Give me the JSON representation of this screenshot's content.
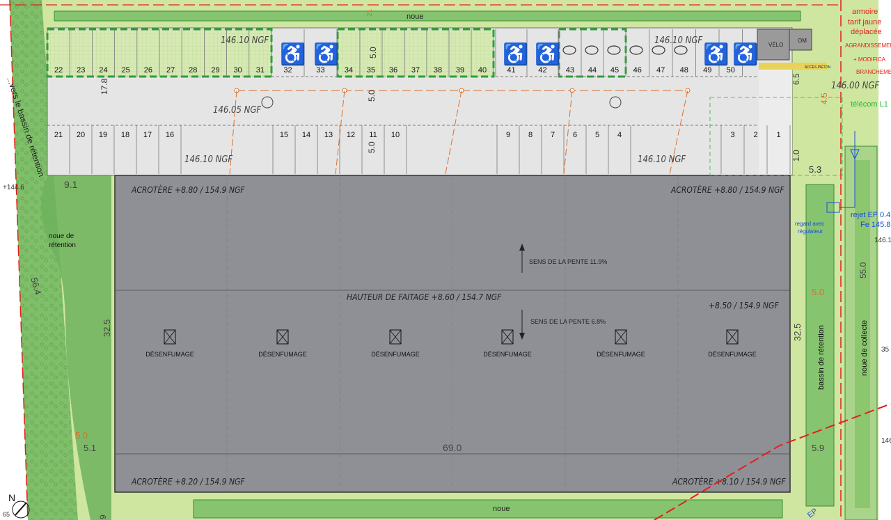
{
  "colors": {
    "background": "#ffffff",
    "green_light": "#cfe6a0",
    "green_mid": "#86c46f",
    "green_dark": "#5ea85a",
    "roof": "#8f9096",
    "pavement": "#e5e5e5",
    "parking_dash": "#2f9e3b",
    "red_line": "#e0211a",
    "sewer": "#d9702a",
    "blue_note": "#1a4fd6",
    "green_note": "#22b83a"
  },
  "labels": {
    "noue_top": "noue",
    "noue_bottom": "noue",
    "noue_retention": "noue de\nrétention",
    "left_vertical": "...vers le bassin de rétention",
    "left_side_value": "+144.6",
    "left_dim_564": "56.4",
    "left_dim_91": "9.1",
    "left_dim_50": "5.0",
    "left_dim_51": "5.1",
    "left_dim_325": "32.5",
    "left_dim_178": "17.8",
    "bottom_left_value": "65",
    "bottom_left_9": "9",
    "north": "N",
    "acrotere_tl": "ACROTÈRE +8.80 / 154.9 NGF",
    "acrotere_tr": "ACROTÈRE +8.80 / 154.9 NGF",
    "acrotere_bl": "ACROTÈRE +8.20 / 154.9 NGF",
    "acrotere_br": "ACROTÈRE +8.10 / 154.9 NGF",
    "faitage": "HAUTEUR DE FAITAGE +8.60 / 154.7 NGF",
    "right_height": "+8.50 / 154.9 NGF",
    "slope_up": "SENS DE LA PENTE 11.9%",
    "slope_down": "SENS DE LA PENTE 6.8%",
    "width_690": "69.0",
    "desenfumage": "DÉSENFUMAGE",
    "ngf_1": "146.10 NGF",
    "ngf_2": "146.10 NGF",
    "ngf_3": "146.05 NGF",
    "ngf_4": "146.10 NGF",
    "ngf_5": "146.10 NGF",
    "ngf_6": "146.00 NGF",
    "dim_50_a": "5.0",
    "dim_50_b": "5.0",
    "dim_50_c": "5.0",
    "dim_65": "6.5",
    "dim_45": "4.5",
    "dim_10": "1.0",
    "dim_53": "5.3",
    "dim_50_r": "5.0",
    "dim_59": "5.9",
    "dim_325_r": "32.5",
    "dim_550": "55.0",
    "dim_21_top": "21",
    "velo": "VÉLO",
    "om": "OM",
    "acces_pieton": "ACCÈS PIÉTON",
    "armoire_1": "armoire",
    "armoire_2": "tarif jaune",
    "armoire_3": "déplacée",
    "agrandissement": "AGRANDISSEMENT",
    "modification": "+ MODIFICA",
    "branchement": "BRANCHEMEN",
    "telecom": "télécom L1",
    "regard_1": "regard avec",
    "regard_2": "régulateur",
    "rejet_1": "rejet EP 0.4",
    "rejet_2": "Fe 145.8",
    "r_1461": "146.1",
    "r_35": "35",
    "r_146": "146",
    "bassin": "bassin de rétention",
    "noue_collecte": "noue de collecte",
    "ep": "EP"
  },
  "parking": {
    "top_row_left": [
      "22",
      "23",
      "24",
      "25",
      "26",
      "27",
      "28",
      "29",
      "30",
      "31"
    ],
    "top_row_mid_a": [
      "32",
      "33"
    ],
    "top_row_mid_b": [
      "34",
      "35",
      "36",
      "37",
      "38",
      "39",
      "40"
    ],
    "top_row_mid_c": [
      "41",
      "42"
    ],
    "top_row_mid_d": [
      "43",
      "44",
      "45"
    ],
    "top_row_right": [
      "46",
      "47",
      "48",
      "49",
      "50"
    ],
    "bottom_row_left": [
      "21",
      "20",
      "19",
      "18",
      "17",
      "16"
    ],
    "bottom_row_mid": [
      "15",
      "14",
      "13",
      "12",
      "11",
      "10"
    ],
    "bottom_row_mid2": [
      "9",
      "8",
      "7",
      "6",
      "5",
      "4"
    ],
    "bottom_row_right": [
      "3",
      "2",
      "1"
    ]
  }
}
